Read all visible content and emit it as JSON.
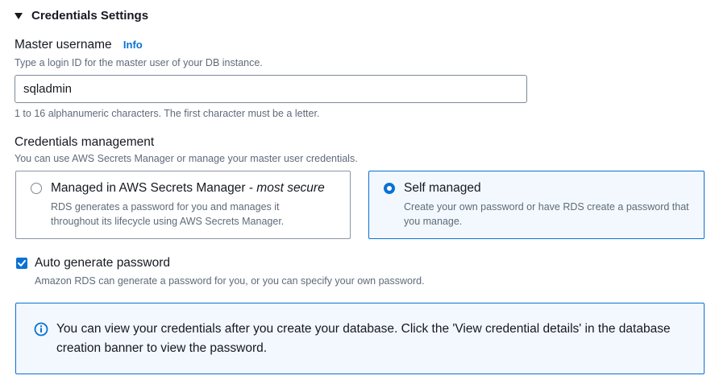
{
  "section": {
    "title": "Credentials Settings"
  },
  "master_username": {
    "label": "Master username",
    "info_link": "Info",
    "description": "Type a login ID for the master user of your DB instance.",
    "value": "sqladmin",
    "constraint": "1 to 16 alphanumeric characters. The first character must be a letter."
  },
  "credentials_management": {
    "label": "Credentials management",
    "description": "You can use AWS Secrets Manager or manage your master user credentials.",
    "options": [
      {
        "title": "Managed in AWS Secrets Manager - ",
        "title_emphasis": "most secure",
        "description": "RDS generates a password for you and manages it throughout its lifecycle using AWS Secrets Manager.",
        "selected": false
      },
      {
        "title": "Self managed",
        "description": "Create your own password or have RDS create a password that you manage.",
        "selected": true
      }
    ]
  },
  "auto_generate_password": {
    "label": "Auto generate password",
    "description": "Amazon RDS can generate a password for you, or you can specify your own password.",
    "checked": true
  },
  "alert": {
    "text": "You can view your credentials after you create your database. Click the 'View credential details' in the database creation banner to view the password."
  },
  "colors": {
    "accent": "#0972d3",
    "selected_bg": "#f2f8fd",
    "text": "#16191f",
    "secondary_text": "#5f6b7a"
  }
}
